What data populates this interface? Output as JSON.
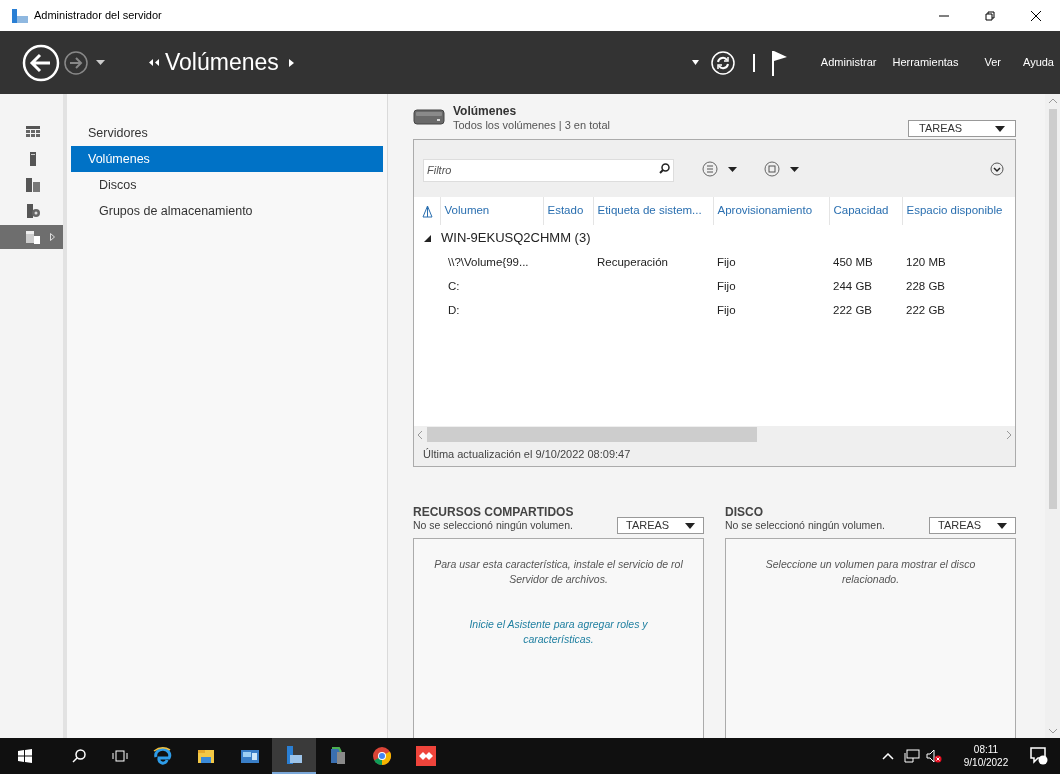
{
  "window": {
    "title": "Administrador del servidor"
  },
  "header": {
    "breadcrumb": "Volúmenes",
    "menu": [
      "Administrar",
      "Herramientas",
      "Ver",
      "Ayuda"
    ]
  },
  "icon_rail": [
    {
      "kind": "dashboard",
      "selected": false
    },
    {
      "kind": "server",
      "selected": false
    },
    {
      "kind": "servers",
      "selected": false
    },
    {
      "kind": "services",
      "selected": false
    },
    {
      "kind": "storage",
      "selected": true
    }
  ],
  "nav": [
    {
      "label": "Servidores",
      "selected": false
    },
    {
      "label": "Volúmenes",
      "selected": true,
      "children": [
        {
          "label": "Discos",
          "selected": false
        },
        {
          "label": "Grupos de almacenamiento",
          "selected": false
        }
      ]
    }
  ],
  "volumes": {
    "title": "Volúmenes",
    "subtitle": "Todos los volúmenes | 3 en total",
    "tasks": "TAREAS",
    "filter_placeholder": "Filtro",
    "columns": [
      "Volumen",
      "Estado",
      "Etiqueta de sistem...",
      "Aprovisionamiento",
      "Capacidad",
      "Espacio disponible"
    ],
    "group": "WIN-9EKUSQ2CHMM (3)",
    "group_expanded": true,
    "rows": [
      {
        "volume": "\\\\?\\Volume{99...",
        "label": "Recuperación",
        "provisioning": "Fijo",
        "capacity": "450 MB",
        "free": "120 MB"
      },
      {
        "volume": "C:",
        "provisioning": "Fijo",
        "capacity": "244 GB",
        "free": "228 GB"
      },
      {
        "volume": "D:",
        "provisioning": "Fijo",
        "capacity": "222 GB",
        "free": "222 GB"
      }
    ],
    "status": "Última actualización el 9/10/2022 08:09:47"
  },
  "panels": [
    {
      "title": "RECURSOS COMPARTIDOS",
      "subtitle": "No se seleccionó ningún volumen.",
      "tasks": "TAREAS",
      "message": "Para usar esta característica, instale el servicio de rol Servidor de archivos.",
      "link": "Inicie el Asistente para agregar roles y características."
    },
    {
      "title": "DISCO",
      "subtitle": "No se seleccionó ningún volumen.",
      "tasks": "TAREAS",
      "message": "Seleccione un volumen para mostrar el disco relacionado."
    }
  ],
  "taskbar": {
    "apps": [
      {
        "kind": "ie",
        "selected": false
      },
      {
        "kind": "folder",
        "selected": false
      },
      {
        "kind": "panel",
        "selected": false
      },
      {
        "kind": "server",
        "selected": true
      },
      {
        "kind": "setup",
        "selected": false
      },
      {
        "kind": "chrome",
        "selected": false
      },
      {
        "kind": "anydesk",
        "selected": false
      }
    ],
    "time": "08:11",
    "date": "9/10/2022"
  }
}
